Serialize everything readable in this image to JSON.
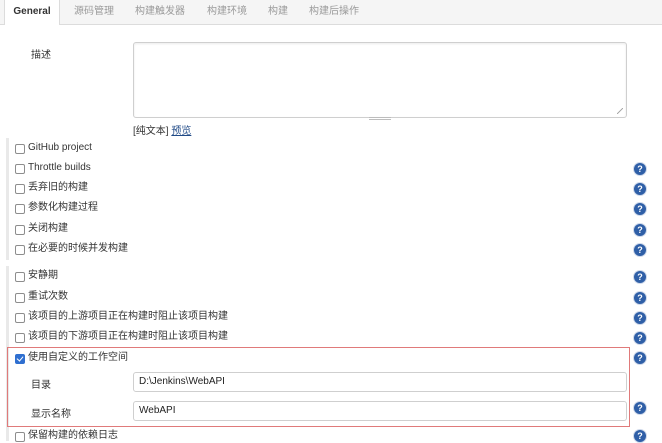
{
  "tabs": [
    "General",
    "源码管理",
    "构建触发器",
    "构建环境",
    "构建",
    "构建后操作"
  ],
  "description": {
    "label": "描述",
    "value": "",
    "format_prefix": "[纯文本]",
    "preview_link": "预览"
  },
  "options_group1": [
    {
      "label": "GitHub project",
      "checked": false,
      "help": false
    },
    {
      "label": "Throttle builds",
      "checked": false,
      "help": true
    },
    {
      "label": "丢弃旧的构建",
      "checked": false,
      "help": true
    },
    {
      "label": "参数化构建过程",
      "checked": false,
      "help": true
    },
    {
      "label": "关闭构建",
      "checked": false,
      "help": true
    },
    {
      "label": "在必要的时候并发构建",
      "checked": false,
      "help": true
    }
  ],
  "options_group2": [
    {
      "label": "安静期",
      "checked": false,
      "help": true
    },
    {
      "label": "重试次数",
      "checked": false,
      "help": true
    },
    {
      "label": "该项目的上游项目正在构建时阻止该项目构建",
      "checked": false,
      "help": true
    },
    {
      "label": "该项目的下游项目正在构建时阻止该项目构建",
      "checked": false,
      "help": true
    },
    {
      "label": "使用自定义的工作空间",
      "checked": true,
      "help": true
    }
  ],
  "custom_workspace": {
    "directory_label": "目录",
    "directory_value": "D:\\Jenkins\\WebAPI",
    "display_name_label": "显示名称",
    "display_name_value": "WebAPI"
  },
  "last_option": {
    "label": "保留构建的依赖日志",
    "checked": false,
    "help": true
  },
  "help_glyph": "?",
  "icons": {
    "help": "help-icon",
    "checkbox": "checkbox"
  },
  "colors": {
    "accent": "#2f5fa7",
    "highlight_border": "#e07a7a",
    "checkbox_checked": "#2f6fd0"
  }
}
